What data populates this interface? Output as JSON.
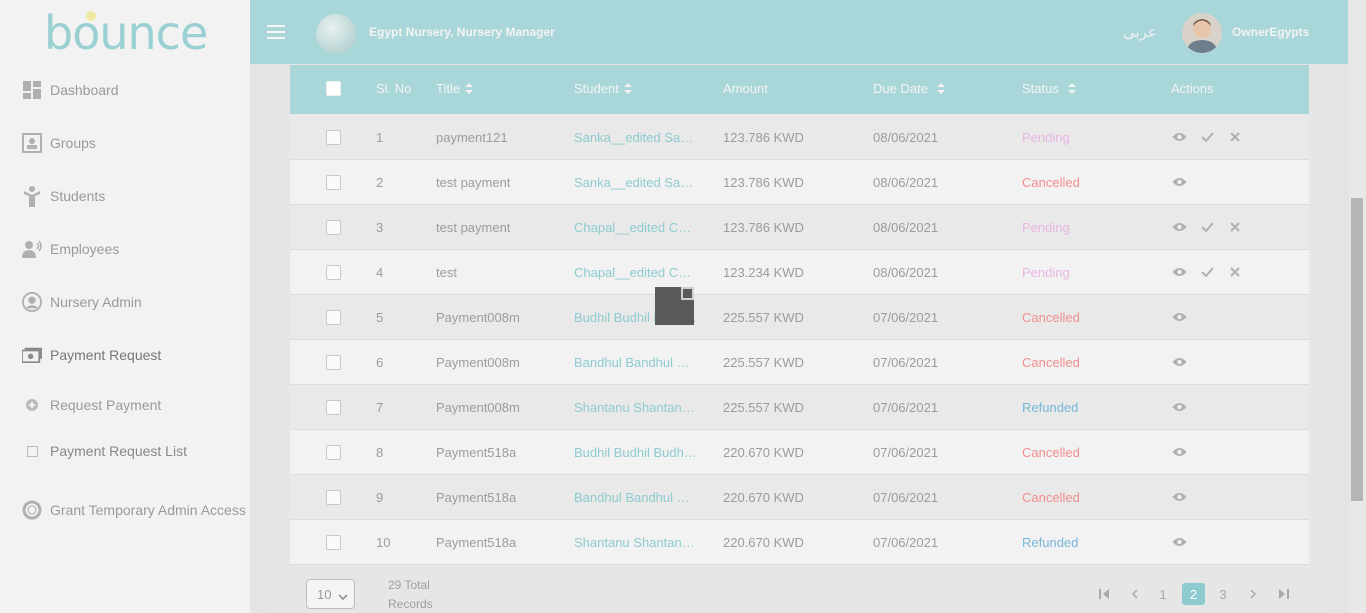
{
  "brand": {
    "logo_text": "bounce",
    "accent": "#a9d6d9"
  },
  "sidebar": {
    "items": [
      {
        "label": "Dashboard",
        "icon": "dashboard-icon"
      },
      {
        "label": "Groups",
        "icon": "groups-icon"
      },
      {
        "label": "Students",
        "icon": "student-icon"
      },
      {
        "label": "Employees",
        "icon": "employees-icon"
      },
      {
        "label": "Nursery Admin",
        "icon": "user-circle-icon"
      },
      {
        "label": "Payment Request",
        "icon": "money-icon"
      }
    ],
    "sub_items": [
      {
        "label": "Request Payment",
        "icon": "plus-circle-icon"
      },
      {
        "label": "Payment Request List",
        "icon": "square-icon"
      }
    ],
    "grant_label": "Grant Temporary Admin Access"
  },
  "header": {
    "org_title": "Egypt Nursery, Nursery Manager",
    "language": "عربي",
    "user_name": "OwnerEgypts"
  },
  "table": {
    "columns": [
      "Sl. No",
      "Title",
      "Student",
      "Amount",
      "Due Date",
      "Status",
      "Actions"
    ],
    "rows": [
      {
        "no": "1",
        "title": "payment121",
        "student": "Sanka__edited Sank...",
        "amount": "123.786 KWD",
        "due": "08/06/2021",
        "status": "Pending"
      },
      {
        "no": "2",
        "title": "test payment",
        "student": "Sanka__edited Sank...",
        "amount": "123.786 KWD",
        "due": "08/06/2021",
        "status": "Cancelled"
      },
      {
        "no": "3",
        "title": "test payment",
        "student": "Chapal__edited Cha...",
        "amount": "123.786 KWD",
        "due": "08/06/2021",
        "status": "Pending"
      },
      {
        "no": "4",
        "title": "test",
        "student": "Chapal__edited Cha...",
        "amount": "123.234 KWD",
        "due": "08/06/2021",
        "status": "Pending"
      },
      {
        "no": "5",
        "title": "Payment008m",
        "student": "Budhil Budhil Budhil ...",
        "amount": "225.557 KWD",
        "due": "07/06/2021",
        "status": "Cancelled"
      },
      {
        "no": "6",
        "title": "Payment008m",
        "student": "Bandhul Bandhul Ba...",
        "amount": "225.557 KWD",
        "due": "07/06/2021",
        "status": "Cancelled"
      },
      {
        "no": "7",
        "title": "Payment008m",
        "student": "Shantanu Shantanu ...",
        "amount": "225.557 KWD",
        "due": "07/06/2021",
        "status": "Refunded"
      },
      {
        "no": "8",
        "title": "Payment518a",
        "student": "Budhil Budhil Budhil ...",
        "amount": "220.670 KWD",
        "due": "07/06/2021",
        "status": "Cancelled"
      },
      {
        "no": "9",
        "title": "Payment518a",
        "student": "Bandhul Bandhul Ba...",
        "amount": "220.670 KWD",
        "due": "07/06/2021",
        "status": "Cancelled"
      },
      {
        "no": "10",
        "title": "Payment518a",
        "student": "Shantanu Shantanu ...",
        "amount": "220.670 KWD",
        "due": "07/06/2021",
        "status": "Refunded"
      }
    ]
  },
  "status_colors": {
    "Pending": "#e9b6e2",
    "Cancelled": "#f08f8f",
    "Refunded": "#78b6d8"
  },
  "footer": {
    "page_size": "10",
    "records_text": "29 Total Records",
    "pages": [
      "1",
      "2",
      "3"
    ],
    "current_page": "2"
  }
}
